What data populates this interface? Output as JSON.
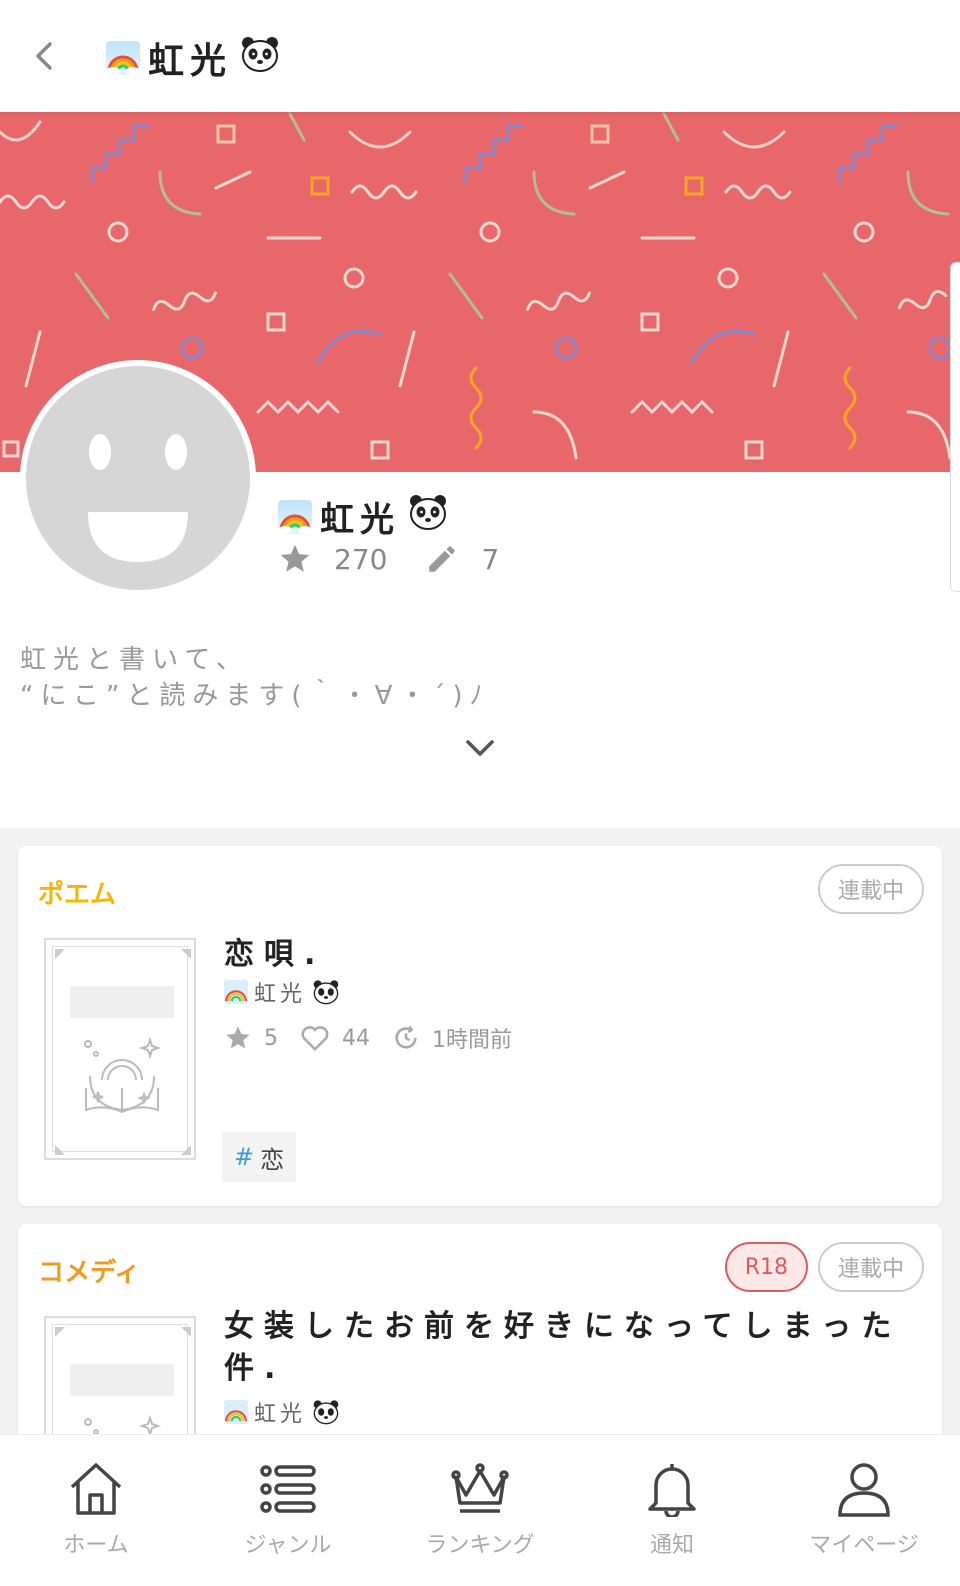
{
  "header": {
    "title": "虹光",
    "back_icon": "chevron-left-icon"
  },
  "profile": {
    "name": "虹光",
    "stars": "270",
    "works": "7",
    "bio_line1": "虹光と書いて、",
    "bio_line2": "“にこ”と読みます(｀・∀・´)ﾉ"
  },
  "works": [
    {
      "genre": "ポエム",
      "genre_color": "#f5b800",
      "status": "連載中",
      "title": "恋唄.",
      "author": "虹光",
      "stars": "5",
      "likes": "44",
      "updated": "1時間前",
      "tag_hash": "#",
      "tag": "恋"
    },
    {
      "genre": "コメディ",
      "genre_color": "#f29a1f",
      "rating": "R18",
      "status": "連載中",
      "title": "女装したお前を好きになってしまった件.",
      "author": "虹光"
    }
  ],
  "nav": [
    {
      "label": "ホーム",
      "icon": "home-icon"
    },
    {
      "label": "ジャンル",
      "icon": "list-icon"
    },
    {
      "label": "ランキング",
      "icon": "crown-icon"
    },
    {
      "label": "通知",
      "icon": "bell-icon"
    },
    {
      "label": "マイページ",
      "icon": "user-icon"
    }
  ]
}
